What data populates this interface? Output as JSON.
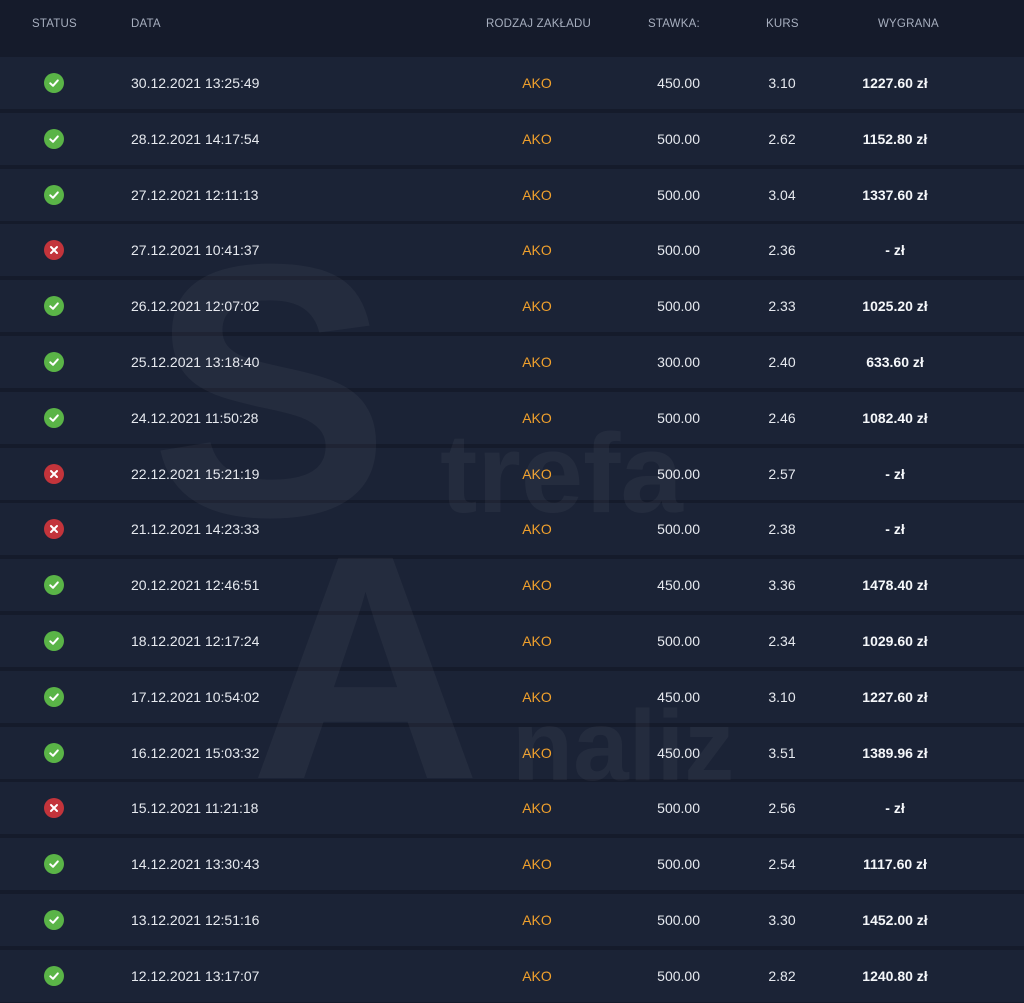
{
  "watermark": {
    "letter_s": "S",
    "word_trefa": "trefa",
    "letter_a": "A",
    "word_naliz": "naliz"
  },
  "colors": {
    "background": "#151b2b",
    "row": "#1b2336",
    "bet_type": "#f0a02c",
    "win_icon": "#5ab447",
    "loss_icon": "#c3343b"
  },
  "headers": {
    "status": "STATUS",
    "date": "DATA",
    "type": "RODZAJ ZAKŁADU",
    "stake": "STAWKA:",
    "odds": "KURS",
    "win": "WYGRANA"
  },
  "rows": [
    {
      "status": "won",
      "status_icon": "check-circle-icon",
      "date": "30.12.2021 13:25:49",
      "type": "AKO",
      "stake": "450.00",
      "odds": "3.10",
      "win": "1227.60 zł"
    },
    {
      "status": "won",
      "status_icon": "check-circle-icon",
      "date": "28.12.2021 14:17:54",
      "type": "AKO",
      "stake": "500.00",
      "odds": "2.62",
      "win": "1152.80 zł"
    },
    {
      "status": "won",
      "status_icon": "check-circle-icon",
      "date": "27.12.2021 12:11:13",
      "type": "AKO",
      "stake": "500.00",
      "odds": "3.04",
      "win": "1337.60 zł"
    },
    {
      "status": "lost",
      "status_icon": "x-circle-icon",
      "date": "27.12.2021 10:41:37",
      "type": "AKO",
      "stake": "500.00",
      "odds": "2.36",
      "win": "- zł"
    },
    {
      "status": "won",
      "status_icon": "check-circle-icon",
      "date": "26.12.2021 12:07:02",
      "type": "AKO",
      "stake": "500.00",
      "odds": "2.33",
      "win": "1025.20 zł"
    },
    {
      "status": "won",
      "status_icon": "check-circle-icon",
      "date": "25.12.2021 13:18:40",
      "type": "AKO",
      "stake": "300.00",
      "odds": "2.40",
      "win": "633.60 zł"
    },
    {
      "status": "won",
      "status_icon": "check-circle-icon",
      "date": "24.12.2021 11:50:28",
      "type": "AKO",
      "stake": "500.00",
      "odds": "2.46",
      "win": "1082.40 zł"
    },
    {
      "status": "lost",
      "status_icon": "x-circle-icon",
      "date": "22.12.2021 15:21:19",
      "type": "AKO",
      "stake": "500.00",
      "odds": "2.57",
      "win": "- zł"
    },
    {
      "status": "lost",
      "status_icon": "x-circle-icon",
      "date": "21.12.2021 14:23:33",
      "type": "AKO",
      "stake": "500.00",
      "odds": "2.38",
      "win": "- zł"
    },
    {
      "status": "won",
      "status_icon": "check-circle-icon",
      "date": "20.12.2021 12:46:51",
      "type": "AKO",
      "stake": "450.00",
      "odds": "3.36",
      "win": "1478.40 zł"
    },
    {
      "status": "won",
      "status_icon": "check-circle-icon",
      "date": "18.12.2021 12:17:24",
      "type": "AKO",
      "stake": "500.00",
      "odds": "2.34",
      "win": "1029.60 zł"
    },
    {
      "status": "won",
      "status_icon": "check-circle-icon",
      "date": "17.12.2021 10:54:02",
      "type": "AKO",
      "stake": "450.00",
      "odds": "3.10",
      "win": "1227.60 zł"
    },
    {
      "status": "won",
      "status_icon": "check-circle-icon",
      "date": "16.12.2021 15:03:32",
      "type": "AKO",
      "stake": "450.00",
      "odds": "3.51",
      "win": "1389.96 zł"
    },
    {
      "status": "lost",
      "status_icon": "x-circle-icon",
      "date": "15.12.2021 11:21:18",
      "type": "AKO",
      "stake": "500.00",
      "odds": "2.56",
      "win": "- zł"
    },
    {
      "status": "won",
      "status_icon": "check-circle-icon",
      "date": "14.12.2021 13:30:43",
      "type": "AKO",
      "stake": "500.00",
      "odds": "2.54",
      "win": "1117.60 zł"
    },
    {
      "status": "won",
      "status_icon": "check-circle-icon",
      "date": "13.12.2021 12:51:16",
      "type": "AKO",
      "stake": "500.00",
      "odds": "3.30",
      "win": "1452.00 zł"
    },
    {
      "status": "won",
      "status_icon": "check-circle-icon",
      "date": "12.12.2021 13:17:07",
      "type": "AKO",
      "stake": "500.00",
      "odds": "2.82",
      "win": "1240.80 zł"
    }
  ]
}
